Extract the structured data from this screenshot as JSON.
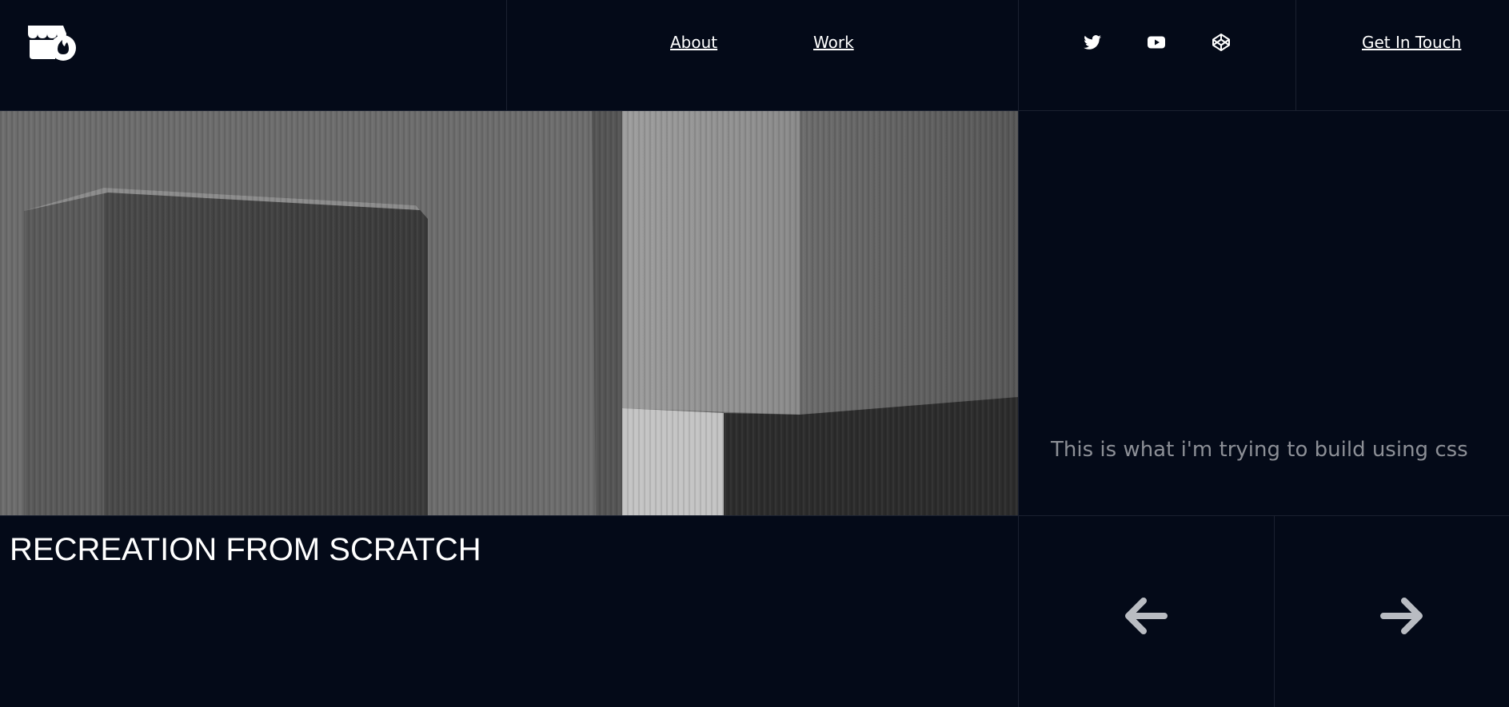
{
  "header": {
    "logo": "store-flame-logo",
    "nav": [
      {
        "label": "About",
        "icon": null
      },
      {
        "label": "Work",
        "icon": null
      }
    ],
    "social": [
      {
        "icon": "twitter-icon"
      },
      {
        "icon": "youtube-icon"
      },
      {
        "icon": "codepen-icon"
      }
    ],
    "cta_label": "Get In Touch"
  },
  "hero": {
    "image": "concrete-blocks-photo",
    "side_text": "This is what i'm trying to build using css"
  },
  "footer": {
    "title": "RECREATION FROM SCRATCH",
    "prev_icon": "arrow-left-icon",
    "next_icon": "arrow-right-icon"
  },
  "colors": {
    "background": "#040a18",
    "divider": "#1b2130",
    "text": "#ffffff",
    "muted_text": "#8c8f96",
    "arrow": "#b9bcc2"
  }
}
